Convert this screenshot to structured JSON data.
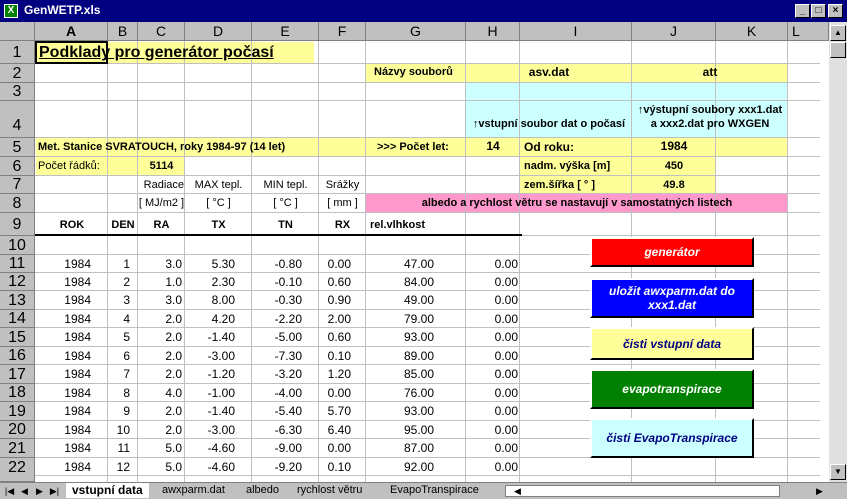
{
  "window": {
    "title": "GenWETP.xls"
  },
  "columns": [
    "A",
    "B",
    "C",
    "D",
    "E",
    "F",
    "G",
    "H",
    "I",
    "J",
    "K",
    "L"
  ],
  "rows": [
    "1",
    "2",
    "3",
    "4",
    "5",
    "6",
    "7",
    "8",
    "9",
    "10",
    "11",
    "12",
    "13",
    "14",
    "15",
    "16",
    "17",
    "18",
    "19",
    "20",
    "21",
    "22"
  ],
  "cells": {
    "a1": "Podklady pro generátor počasí",
    "g2": "Názvy souborů",
    "i2": "asv.dat",
    "j2": "att",
    "i3": "↑vstupní soubor dat o počasí",
    "j3": "↑výstupní soubory xxx1.dat a xxx2.dat pro WXGEN",
    "a5": "Met. Stanice SVRATOUCH, roky 1984-97 (14 let)",
    "g5": ">>> Počet let:",
    "h5": "14",
    "i5": "Od roku:",
    "j5": "1984",
    "a6": "Počet řádků:",
    "c6": "5114",
    "i6": "nadm. výška [m]",
    "j6": "450",
    "i7": "zem.šířka [ ° ]",
    "j7": "49.8",
    "c7": "Radiace",
    "d7": "MAX tepl.",
    "e7": "MIN tepl.",
    "f7": "Srážky",
    "c8": "[ MJ/m2 ]",
    "d8": "[ °C ]",
    "e8": "[ °C ]",
    "f8": "[ mm ]",
    "g8": "albedo a rychlost větru se nastavují v samostatných listech"
  },
  "table": {
    "headers": [
      "ROK",
      "DEN",
      "RA",
      "TX",
      "TN",
      "RX",
      "rel.vlhkost"
    ],
    "rows": [
      [
        "1984",
        "1",
        "3.0",
        "5.30",
        "-0.80",
        "0.00",
        "47.00",
        "0.00"
      ],
      [
        "1984",
        "2",
        "1.0",
        "2.30",
        "-0.10",
        "0.60",
        "84.00",
        "0.00"
      ],
      [
        "1984",
        "3",
        "3.0",
        "8.00",
        "-0.30",
        "0.90",
        "49.00",
        "0.00"
      ],
      [
        "1984",
        "4",
        "2.0",
        "4.20",
        "-2.20",
        "2.00",
        "79.00",
        "0.00"
      ],
      [
        "1984",
        "5",
        "2.0",
        "-1.40",
        "-5.00",
        "0.60",
        "93.00",
        "0.00"
      ],
      [
        "1984",
        "6",
        "2.0",
        "-3.00",
        "-7.30",
        "0.10",
        "89.00",
        "0.00"
      ],
      [
        "1984",
        "7",
        "2.0",
        "-1.20",
        "-3.20",
        "1.20",
        "85.00",
        "0.00"
      ],
      [
        "1984",
        "8",
        "4.0",
        "-1.00",
        "-4.00",
        "0.00",
        "76.00",
        "0.00"
      ],
      [
        "1984",
        "9",
        "2.0",
        "-1.40",
        "-5.40",
        "5.70",
        "93.00",
        "0.00"
      ],
      [
        "1984",
        "10",
        "2.0",
        "-3.00",
        "-6.30",
        "6.40",
        "95.00",
        "0.00"
      ],
      [
        "1984",
        "11",
        "5.0",
        "-4.60",
        "-9.00",
        "0.00",
        "87.00",
        "0.00"
      ],
      [
        "1984",
        "12",
        "5.0",
        "-4.60",
        "-9.20",
        "0.10",
        "92.00",
        "0.00"
      ]
    ]
  },
  "buttons": {
    "generator": "generátor",
    "save": "uložit awxparm.dat do xxx1.dat",
    "read_input": "čisti vstupní data",
    "evapo": "evapotranspirace",
    "read_evapo": "čisti EvapoTranspirace"
  },
  "tabs": [
    "vstupní data",
    "awxparm.dat",
    "albedo",
    "rychlost větru",
    "EvapoTranspirace"
  ],
  "colors": {
    "yellow": "#ffff99",
    "cyan": "#ccffff",
    "pink": "#ff99cc",
    "red": "#ff0000",
    "blue": "#0000ff",
    "green": "#008000",
    "title": "#000080"
  }
}
